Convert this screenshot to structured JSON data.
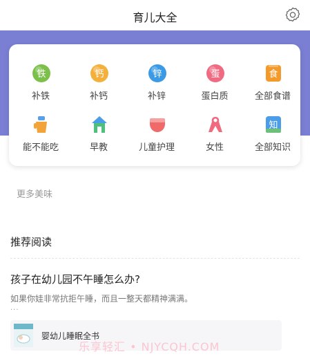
{
  "header": {
    "title": "育儿大全"
  },
  "grid": {
    "items": [
      {
        "label": "补铁",
        "icon": "iron-icon",
        "glyph": "铁",
        "color": "#7cc04a"
      },
      {
        "label": "补钙",
        "icon": "calcium-icon",
        "glyph": "钙",
        "color": "#f4b03c"
      },
      {
        "label": "补锌",
        "icon": "zinc-icon",
        "glyph": "锌",
        "color": "#3a9ae6"
      },
      {
        "label": "蛋白质",
        "icon": "protein-icon",
        "glyph": "蛋",
        "color": "#f06a82"
      },
      {
        "label": "全部食谱",
        "icon": "recipes-icon",
        "glyph": "食",
        "color": "#f39a2a"
      },
      {
        "label": "能不能吃",
        "icon": "can-eat-icon",
        "glyph": "",
        "color": "#f2a33a"
      },
      {
        "label": "早教",
        "icon": "early-education-icon",
        "glyph": "",
        "color": "#4cc07c"
      },
      {
        "label": "儿童护理",
        "icon": "child-care-icon",
        "glyph": "",
        "color": "#f06a6a"
      },
      {
        "label": "女性",
        "icon": "women-ribbon-icon",
        "glyph": "",
        "color": "#f06a80"
      },
      {
        "label": "全部知识",
        "icon": "knowledge-icon",
        "glyph": "知",
        "color": "#4a9de6"
      }
    ]
  },
  "more": {
    "label": "更多美味"
  },
  "recommend": {
    "title": "推荐阅读",
    "article": {
      "title": "孩子在幼儿园不午睡怎么办?",
      "desc": "如果你娃非常抗拒午睡，而且一整天都精神满满。",
      "ellipsis": "..."
    },
    "book": {
      "name": "婴幼儿睡眠全书"
    }
  },
  "watermark": {
    "text": "乐享轻汇 • NJYCQH.COM"
  }
}
